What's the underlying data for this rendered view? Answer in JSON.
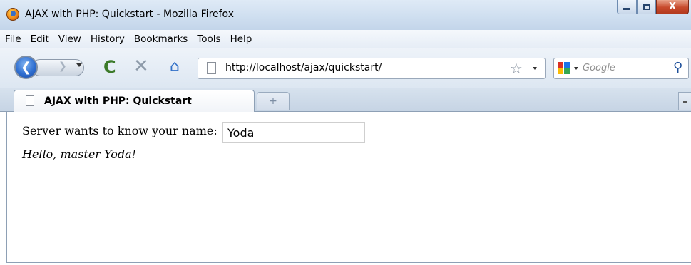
{
  "window": {
    "title": "AJAX with PHP: Quickstart - Mozilla Firefox"
  },
  "caption_buttons": {
    "close_glyph": "X"
  },
  "menu": {
    "items": [
      {
        "accel": "F",
        "rest": "ile"
      },
      {
        "accel": "E",
        "rest": "dit"
      },
      {
        "accel": "V",
        "rest": "iew"
      },
      {
        "pre": "Hi",
        "accel": "s",
        "rest": "tory"
      },
      {
        "accel": "B",
        "rest": "ookmarks"
      },
      {
        "accel": "T",
        "rest": "ools"
      },
      {
        "accel": "H",
        "rest": "elp"
      }
    ]
  },
  "navigation": {
    "url": "http://localhost/ajax/quickstart/",
    "search_placeholder": "Google",
    "icons": {
      "back": "back-arrow-icon",
      "forward": "forward-arrow-icon",
      "reload": "reload-icon",
      "stop": "stop-icon",
      "home": "home-icon",
      "bookmark": "star-icon",
      "search": "magnifier-icon"
    }
  },
  "tabs": [
    {
      "title": "AJAX with PHP: Quickstart",
      "active": true
    }
  ],
  "page": {
    "prompt": "Server wants to know your name:",
    "name_value": "Yoda",
    "response": "Hello, master Yoda!"
  },
  "colors": {
    "chrome_blue": "#cfdff0",
    "close_red": "#c74a2c"
  }
}
